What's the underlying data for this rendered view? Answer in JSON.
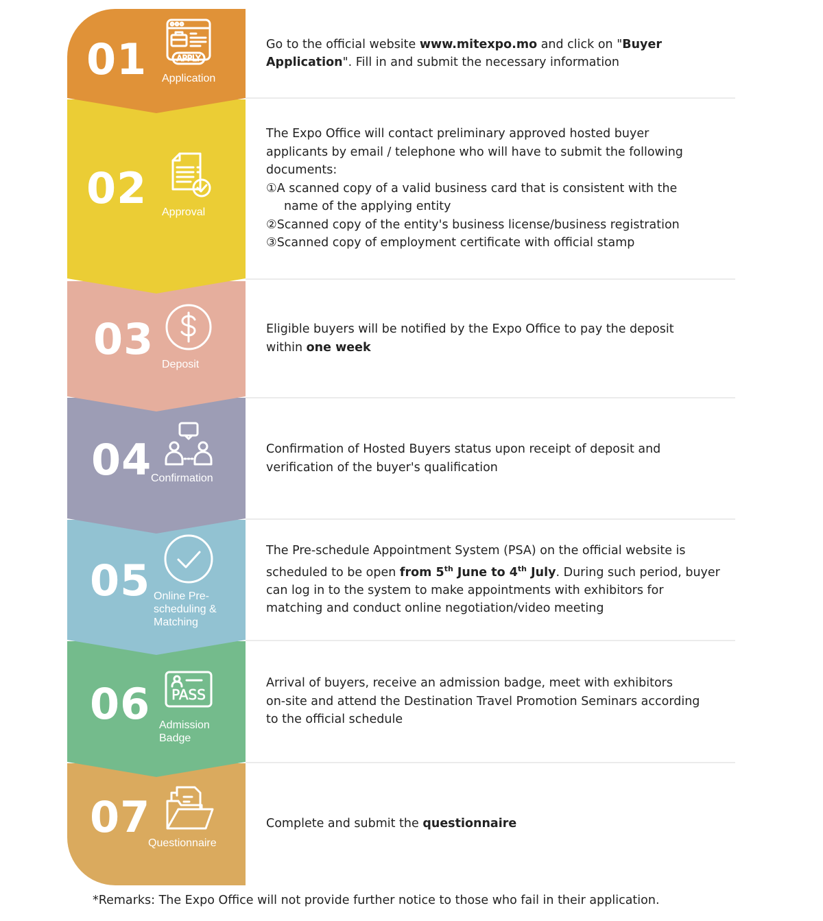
{
  "steps": [
    {
      "number": "01",
      "label": "Application",
      "icon": "apply-web-icon",
      "color": "#E09238",
      "lines": [
        [
          {
            "t": "Go to the official website "
          },
          {
            "t": "www.mitexpo.mo",
            "b": true
          },
          {
            "t": " and click on \""
          },
          {
            "t": "Buyer",
            "b": true
          }
        ],
        [
          {
            "t": "Application",
            "b": true
          },
          {
            "t": "\". Fill in and submit the necessary information"
          }
        ]
      ]
    },
    {
      "number": "02",
      "label": "Approval",
      "icon": "document-check-icon",
      "color": "#EBCD35",
      "lines": [
        [
          {
            "t": "The Expo Office will contact preliminary approved hosted buyer"
          }
        ],
        [
          {
            "t": "applicants by email / telephone who will have to submit the following"
          }
        ],
        [
          {
            "t": "documents:"
          }
        ],
        [
          {
            "t": "①A scanned copy of a valid business card that is consistent with the"
          }
        ],
        [
          {
            "t": "name of the applying entity",
            "i": true
          }
        ],
        [
          {
            "t": "②Scanned copy of the entity's business license/business registration"
          }
        ],
        [
          {
            "t": "③Scanned copy of employment certificate with official stamp"
          }
        ]
      ]
    },
    {
      "number": "03",
      "label": "Deposit",
      "icon": "dollar-circle-icon",
      "color": "#E5AE9D",
      "lines": [
        [
          {
            "t": "Eligible buyers will be notified by the Expo Office to pay the deposit"
          }
        ],
        [
          {
            "t": "within "
          },
          {
            "t": "one week",
            "b": true
          }
        ]
      ]
    },
    {
      "number": "04",
      "label": "Confirmation",
      "icon": "people-chat-icon",
      "color": "#9D9DB5",
      "lines": [
        [
          {
            "t": "Confirmation of Hosted Buyers status upon receipt of deposit and"
          }
        ],
        [
          {
            "t": "verification of the buyer's qualification"
          }
        ]
      ]
    },
    {
      "number": "05",
      "label": "Online Pre-\nscheduling &\nMatching",
      "icon": "check-circle-icon",
      "color": "#92C2D2",
      "lines": [
        [
          {
            "t": "The Pre-schedule Appointment System (PSA) on the official website is"
          }
        ],
        [
          {
            "t": "scheduled to be open "
          },
          {
            "t": "from 5",
            "b": true
          },
          {
            "t": "th",
            "b": true,
            "s": true
          },
          {
            "t": " June to 4",
            "b": true
          },
          {
            "t": "th",
            "b": true,
            "s": true
          },
          {
            "t": " July",
            "b": true
          },
          {
            "t": ". During such period, buyer"
          }
        ],
        [
          {
            "t": "can log in to the system to make appointments with exhibitors for"
          }
        ],
        [
          {
            "t": "matching and conduct online negotiation/video meeting"
          }
        ]
      ]
    },
    {
      "number": "06",
      "label": "Admission\nBadge",
      "icon": "pass-badge-icon",
      "color": "#74BB8C",
      "lines": [
        [
          {
            "t": "Arrival of buyers, receive an admission badge, meet with exhibitors"
          }
        ],
        [
          {
            "t": "on-site and attend the Destination Travel Promotion Seminars according"
          }
        ],
        [
          {
            "t": "to the official schedule"
          }
        ]
      ]
    },
    {
      "number": "07",
      "label": "Questionnaire",
      "icon": "folder-documents-icon",
      "color": "#DAAA5E",
      "lines": [
        [
          {
            "t": "Complete and submit the "
          },
          {
            "t": "questionnaire",
            "b": true
          }
        ]
      ]
    }
  ],
  "remarks": "*Remarks: The Expo Office will not provide further notice to those who fail in their application."
}
